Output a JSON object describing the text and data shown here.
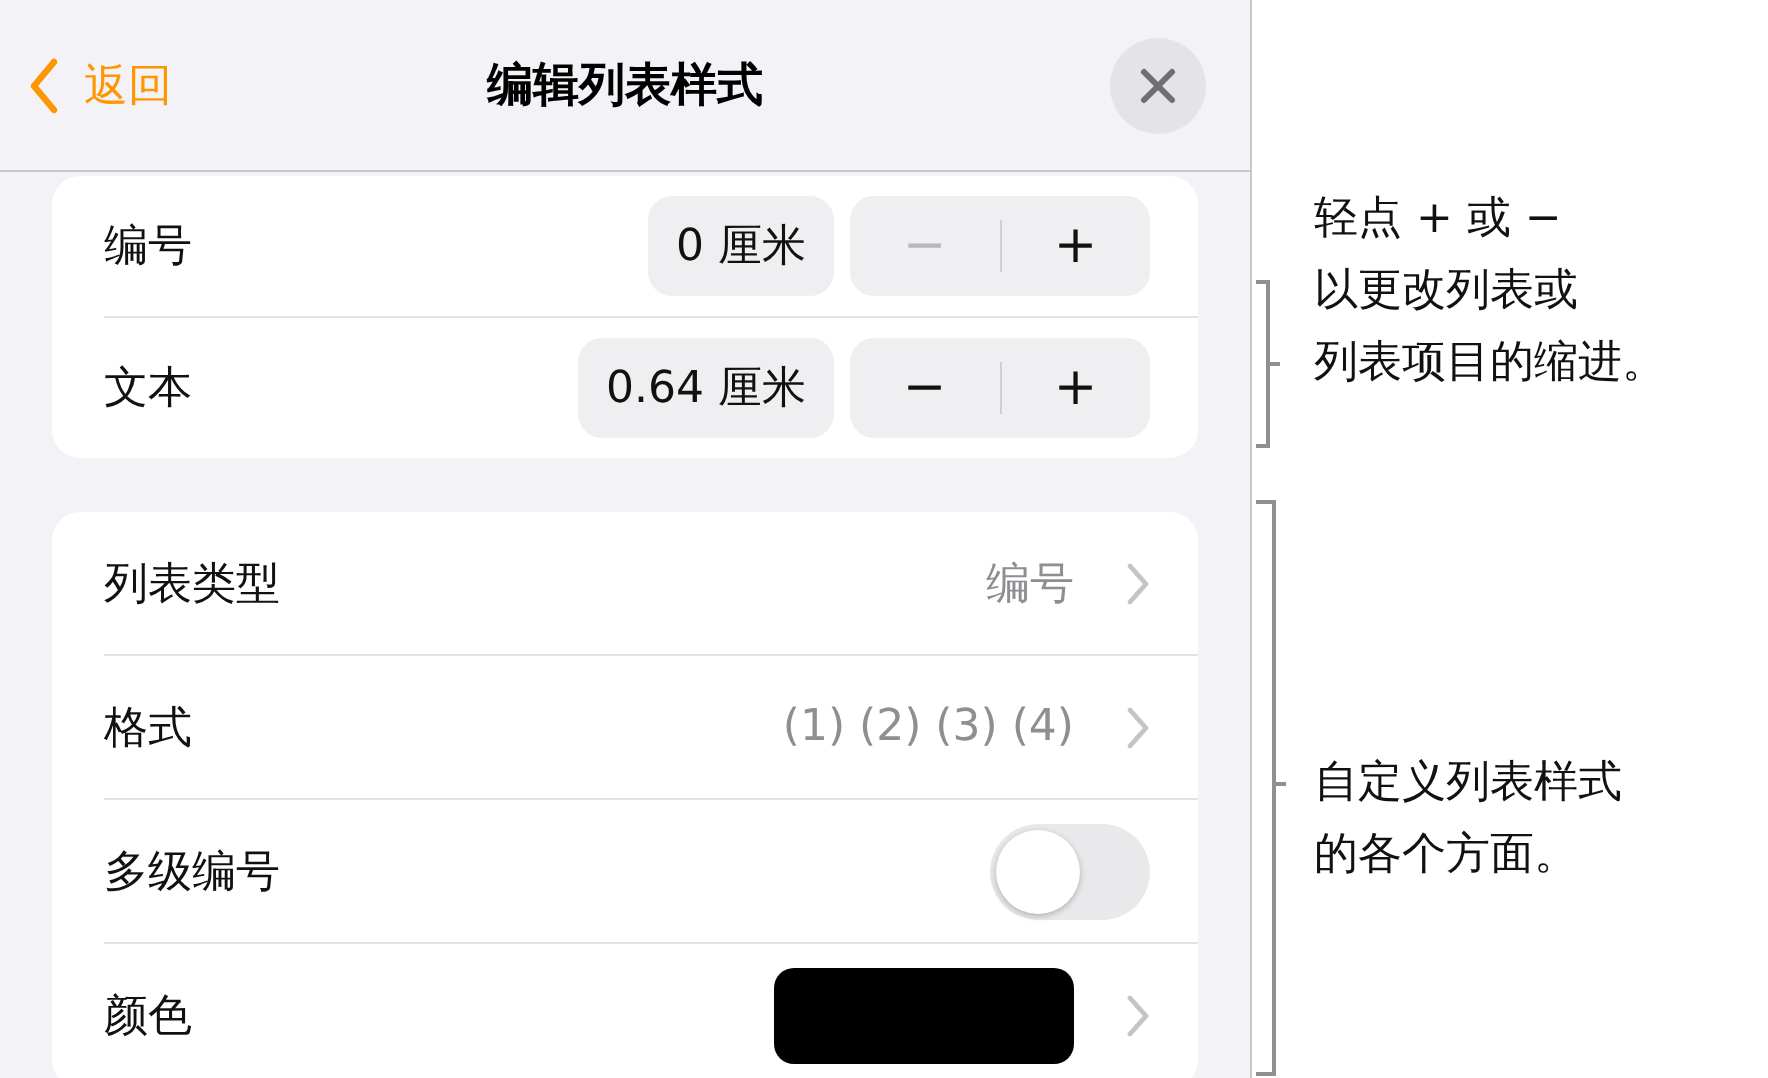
{
  "header": {
    "back": "返回",
    "title": "编辑列表样式"
  },
  "indents": [
    {
      "label": "编号",
      "value": "0 厘米",
      "minus": "−",
      "plus": "+",
      "minus_disabled": true
    },
    {
      "label": "文本",
      "value": "0.64 厘米",
      "minus": "−",
      "plus": "+",
      "minus_disabled": false
    }
  ],
  "settings": [
    {
      "kind": "nav",
      "label": "列表类型",
      "value": "编号"
    },
    {
      "kind": "nav",
      "label": "格式",
      "value": "(1) (2) (3) (4)"
    },
    {
      "kind": "toggle",
      "label": "多级编号",
      "on": false
    },
    {
      "kind": "color",
      "label": "颜色",
      "color": "#000000"
    }
  ],
  "callouts": [
    {
      "lines": [
        "轻点 + 或 −",
        "以更改列表或",
        "列表项目的缩进。"
      ]
    },
    {
      "lines": [
        "自定义列表样式",
        "的各个方面。"
      ]
    }
  ]
}
